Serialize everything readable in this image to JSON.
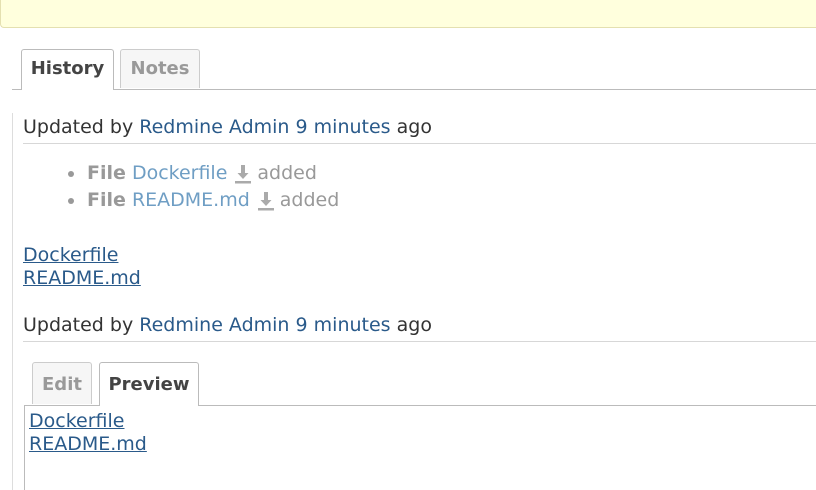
{
  "tabs": [
    {
      "label": "History",
      "selected": true
    },
    {
      "label": "Notes",
      "selected": false
    }
  ],
  "journals": [
    {
      "prefix": "Updated by",
      "author": "Redmine Admin",
      "time": "9 minutes",
      "suffix": "ago",
      "details": [
        {
          "label": "File",
          "file": "Dockerfile",
          "action": "added",
          "icon": "download-icon"
        },
        {
          "label": "File",
          "file": "README.md",
          "action": "added",
          "icon": "download-icon"
        }
      ],
      "notes": [
        "Dockerfile",
        "README.md"
      ]
    },
    {
      "prefix": "Updated by",
      "author": "Redmine Admin",
      "time": "9 minutes",
      "suffix": "ago"
    }
  ],
  "editor": {
    "tabs": [
      {
        "label": "Edit",
        "selected": false
      },
      {
        "label": "Preview",
        "selected": true
      }
    ],
    "preview_lines": [
      "Dockerfile",
      "README.md"
    ]
  },
  "colors": {
    "link": "#2a5a8a",
    "file_link": "#6f9ec4",
    "notice_background": "#ffffdd"
  }
}
